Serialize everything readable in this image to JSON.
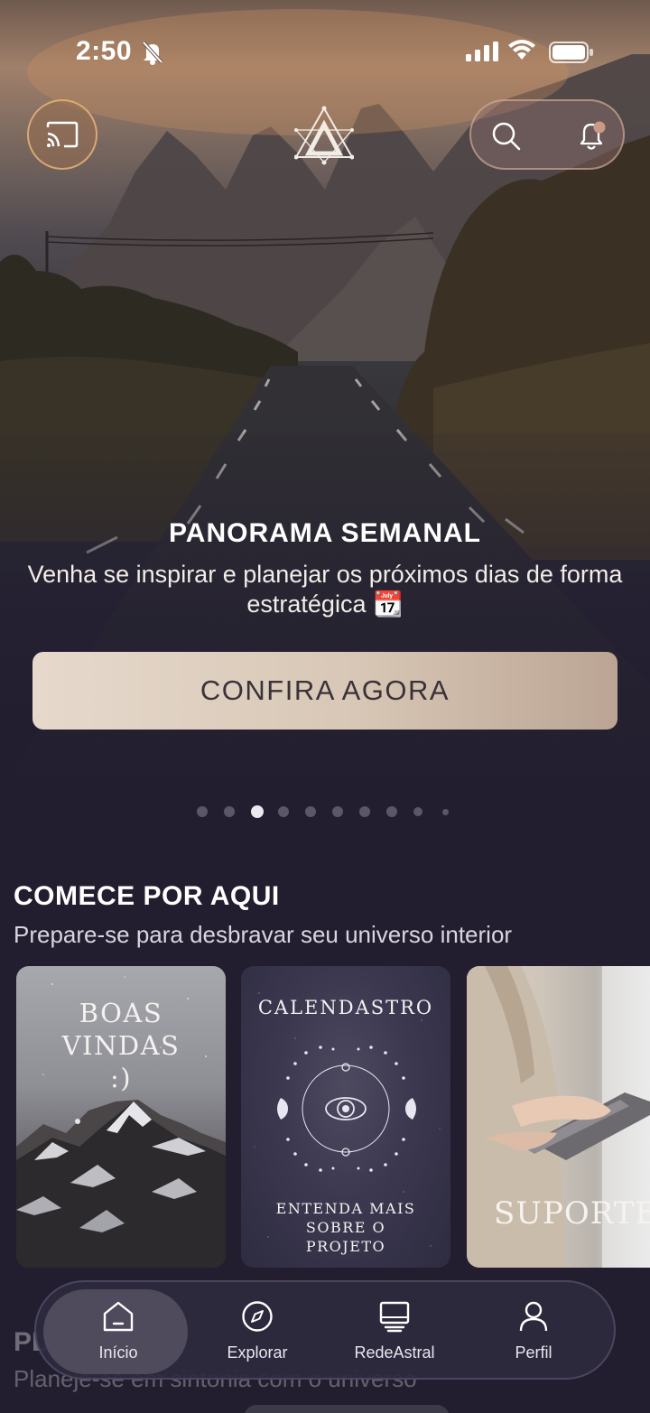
{
  "status_bar": {
    "time": "2:50"
  },
  "top_bar": {
    "cast_icon": "cast-icon",
    "logo_icon": "astral-triangle-logo",
    "search_icon": "search-icon",
    "notification_icon": "bell-icon"
  },
  "hero": {
    "title": "PANORAMA SEMANAL",
    "subtitle": "Venha se inspirar e planejar os próximos dias de forma estratégica 📆",
    "cta_label": "CONFIRA AGORA",
    "page_count": 10,
    "active_page": 3
  },
  "section": {
    "title": "COMECE POR AQUI",
    "subtitle": "Prepare-se para desbravar seu universo interior",
    "cards": [
      {
        "title": "BOAS VINDAS :)"
      },
      {
        "title": "CALENDASTRO",
        "subtitle": "ENTENDA MAIS SOBRE O PROJETO"
      },
      {
        "title": "SUPORTE"
      }
    ]
  },
  "next_section": {
    "title": "PL",
    "subtitle": "Planeje-se em sintonia com o universo"
  },
  "nav": {
    "items": [
      {
        "label": "Início",
        "icon": "home-icon"
      },
      {
        "label": "Explorar",
        "icon": "compass-icon"
      },
      {
        "label": "RedeAstral",
        "icon": "monitor-icon"
      },
      {
        "label": "Perfil",
        "icon": "person-icon"
      }
    ],
    "active_index": 0
  },
  "colors": {
    "background": "#221e30",
    "cta_start": "#e6d9cc",
    "cta_end": "#bba493",
    "nav_bg": "#2e2a3e",
    "accent_border": "#e6b478"
  }
}
